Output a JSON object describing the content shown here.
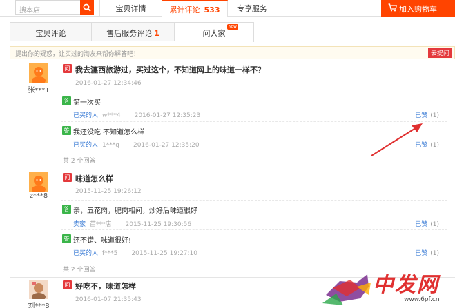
{
  "topbar": {
    "search_placeholder": "搜本店",
    "tabs": [
      {
        "label": "宝贝详情"
      },
      {
        "label": "累计评论",
        "count": "533"
      },
      {
        "label": "专享服务"
      }
    ],
    "cart_label": "加入购物车"
  },
  "subtabs": [
    {
      "label": "宝贝评论"
    },
    {
      "label": "售后服务评论",
      "count": "1"
    },
    {
      "label": "问大家",
      "badge": "NEW"
    }
  ],
  "askbar": {
    "placeholder": "提出你的疑惑，让买过的淘友来帮你解答吧！",
    "button": "去提问"
  },
  "questions": [
    {
      "user": "张***1",
      "q_icon": "问",
      "question": "我去瀍西旅游过，买过这个，不知道网上的味道一样不？",
      "time": "2016-01-27 12:34:46",
      "answers": [
        {
          "a_icon": "答",
          "text": "第一次买",
          "who": "已买的人",
          "name": "w***4",
          "time": "2016-01-27 12:35:23",
          "like": "已赞",
          "count": "(1)"
        },
        {
          "a_icon": "答",
          "text": "我还没吃 不知道怎么样",
          "who": "已买的人",
          "name": "1***q",
          "time": "2016-01-27 12:35:20",
          "like": "已赞",
          "count": "(1)"
        }
      ],
      "total": "共 2 个回答"
    },
    {
      "user": "z***8",
      "q_icon": "问",
      "question": "味道怎么样",
      "time": "2015-11-25 19:26:12",
      "answers": [
        {
          "a_icon": "答",
          "text": "亲，五花肉，肥肉相间，炒好后味道很好",
          "who": "卖家",
          "name": "苗***店",
          "time": "2015-11-25 19:30:56",
          "like": "已赞",
          "count": "(1)"
        },
        {
          "a_icon": "答",
          "text": "还不错、味道很好!",
          "who": "已买的人",
          "name": "f***5",
          "time": "2015-11-25 19:27:10",
          "like": "已赞",
          "count": "(1)"
        }
      ],
      "total": "共 2 个回答"
    },
    {
      "user": "刘***8",
      "q_icon": "问",
      "question": "好吃不，味道怎样",
      "time": "2016-01-07 21:35:43"
    }
  ],
  "watermark": {
    "brand": "中发网",
    "url": "www.6pf.cn"
  },
  "colors": {
    "accent": "#ff4400",
    "question_red": "#e4393c",
    "answer_green": "#3bb54a",
    "link_blue": "#3a7bd5"
  }
}
